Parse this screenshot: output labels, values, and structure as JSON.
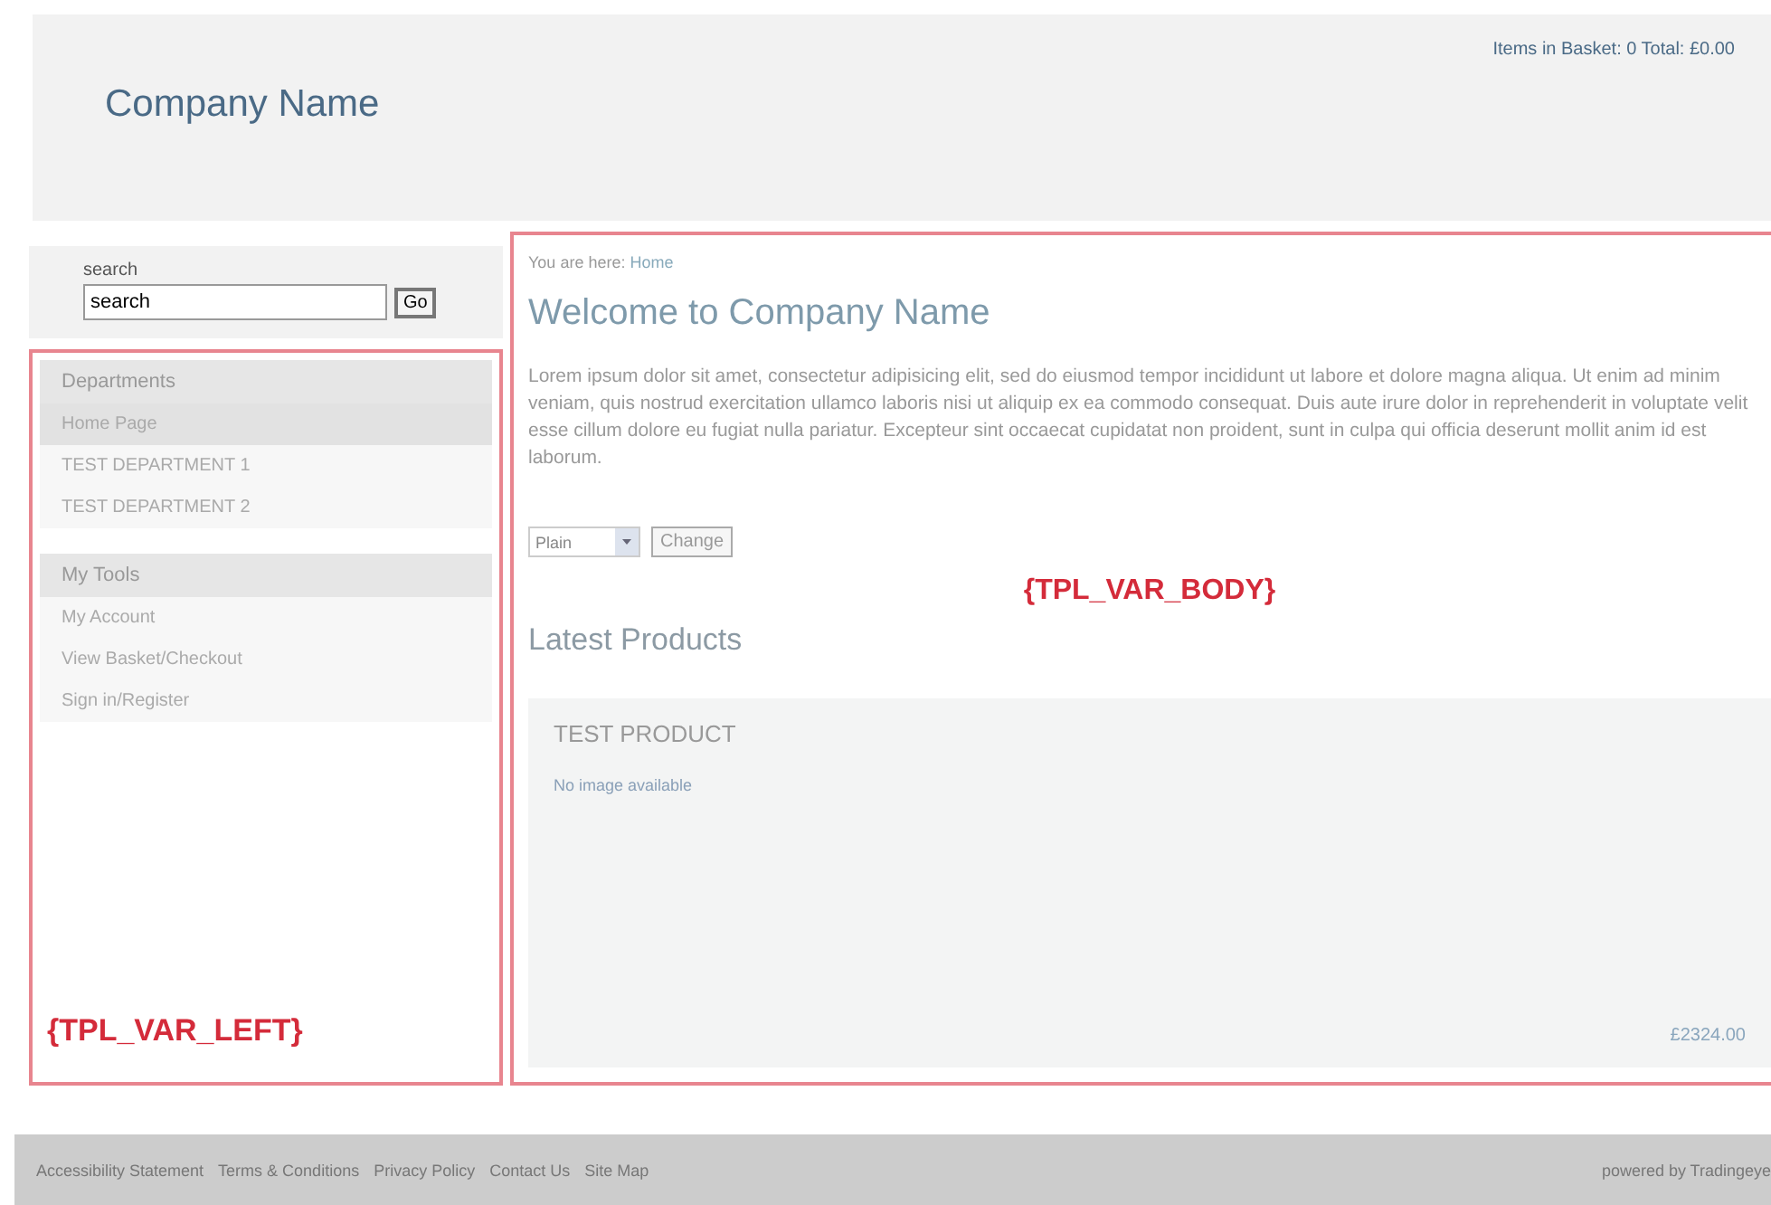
{
  "header": {
    "company_name": "Company Name",
    "basket_summary": "Items in Basket: 0 Total: £0.00"
  },
  "search": {
    "label": "search",
    "value": "search",
    "button": "Go"
  },
  "sidebar": {
    "sections": [
      {
        "title": "Departments",
        "items": [
          {
            "label": "Home Page",
            "selected": true
          },
          {
            "label": "TEST DEPARTMENT 1",
            "selected": false
          },
          {
            "label": "TEST DEPARTMENT 2",
            "selected": false
          }
        ]
      },
      {
        "title": "My Tools",
        "items": [
          {
            "label": "My Account",
            "selected": false
          },
          {
            "label": "View Basket/Checkout",
            "selected": false
          },
          {
            "label": "Sign in/Register",
            "selected": false
          }
        ]
      }
    ],
    "template_var": "{TPL_VAR_LEFT}"
  },
  "body": {
    "breadcrumb_prefix": "You are here:",
    "breadcrumb_link": "Home",
    "heading": "Welcome to Company Name",
    "paragraph": "Lorem ipsum dolor sit amet, consectetur adipisicing elit, sed do eiusmod tempor incididunt ut labore et dolore magna aliqua. Ut enim ad minim veniam, quis nostrud exercitation ullamco laboris nisi ut aliquip ex ea commodo consequat. Duis aute irure dolor in reprehenderit in voluptate velit esse cillum dolore eu fugiat nulla pariatur. Excepteur sint occaecat cupidatat non proident, sunt in culpa qui officia deserunt mollit anim id est laborum.",
    "style_select": "Plain",
    "change_button": "Change",
    "template_var": "{TPL_VAR_BODY}",
    "latest_heading": "Latest Products",
    "products": [
      {
        "name": "TEST PRODUCT",
        "image_note": "No image available",
        "price": "£2324.00"
      }
    ]
  },
  "footer": {
    "links": [
      "Accessibility Statement",
      "Terms & Conditions",
      "Privacy Policy",
      "Contact Us",
      "Site Map"
    ],
    "powered_by": "powered by Tradingeye"
  }
}
